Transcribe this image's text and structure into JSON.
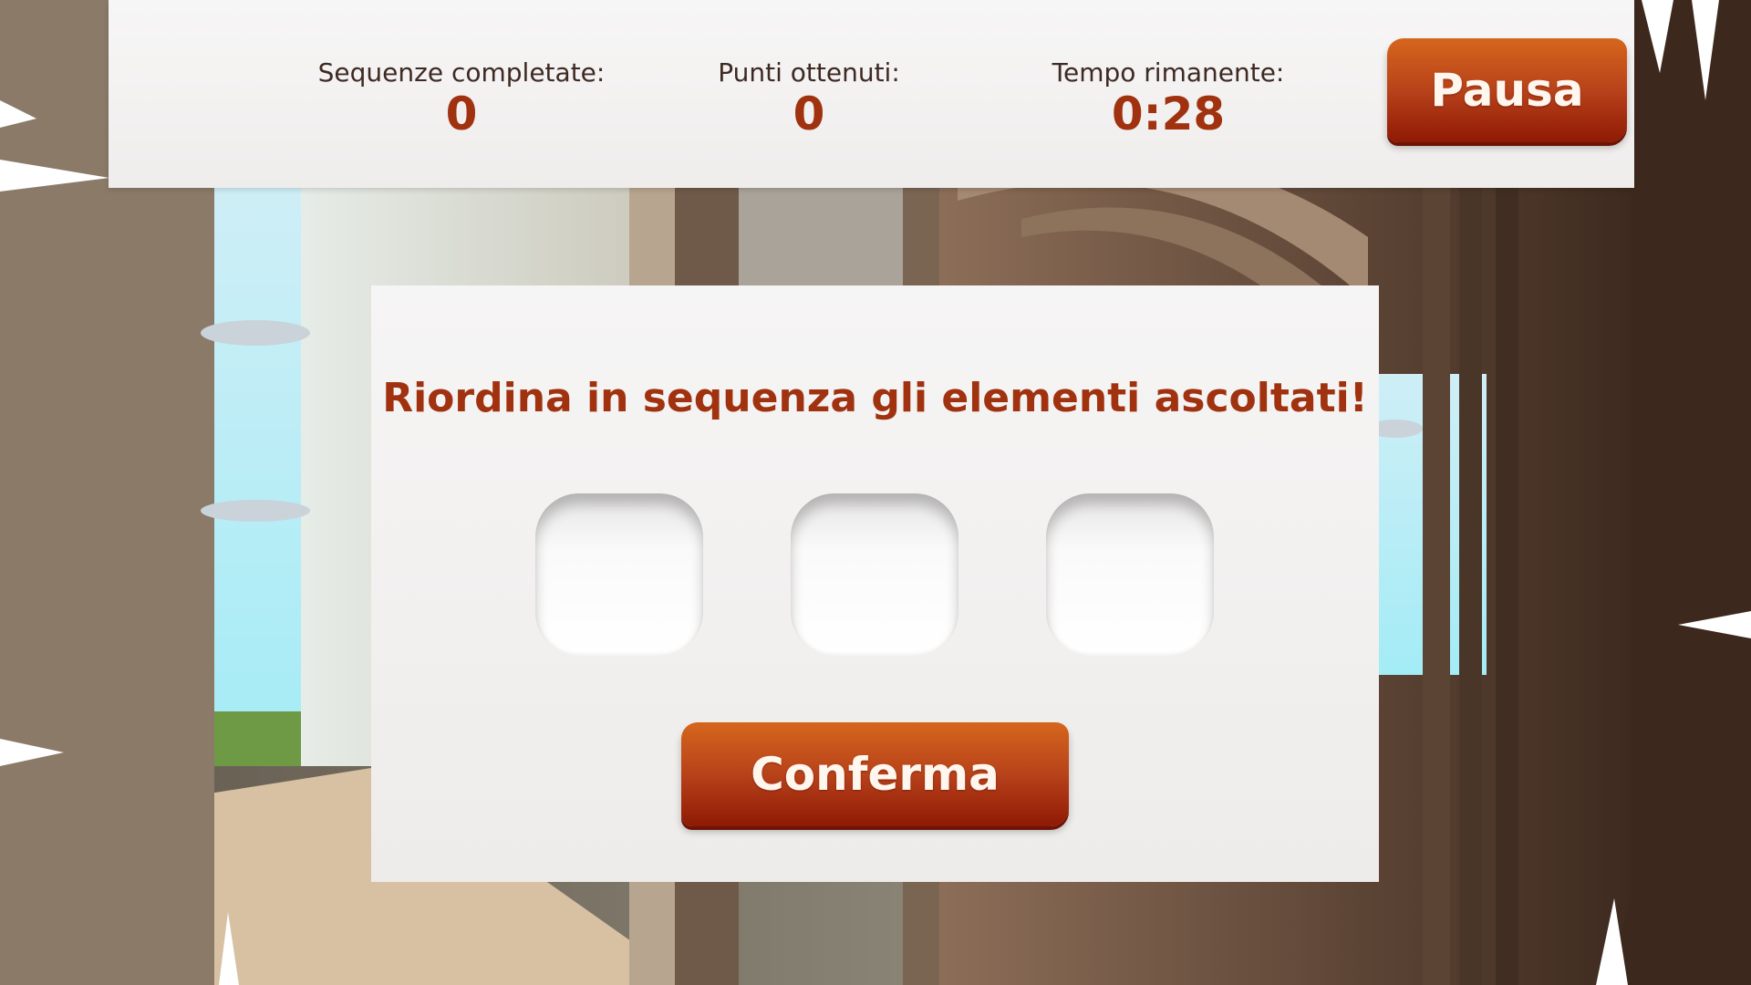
{
  "hud": {
    "sequences_label": "Sequenze completate:",
    "sequences_value": "0",
    "points_label": "Punti ottenuti:",
    "points_value": "0",
    "time_label": "Tempo rimanente:",
    "time_value": "0:28",
    "pause_label": "Pausa"
  },
  "panel": {
    "prompt": "Riordina in sequenza gli elementi ascoltati!",
    "slots": [
      "",
      "",
      ""
    ],
    "confirm_label": "Conferma"
  },
  "colors": {
    "accent": "#a0320f",
    "button_top": "#d5661d",
    "button_bottom": "#8f1a05",
    "panel_bg": "#f3f2f1"
  }
}
